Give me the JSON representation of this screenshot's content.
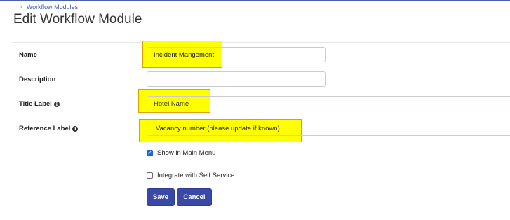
{
  "breadcrumb": {
    "separator": ">",
    "current": "Workflow Modules"
  },
  "page": {
    "title": "Edit Workflow Module"
  },
  "form": {
    "name": {
      "label": "Name",
      "value": "Incident Mangement"
    },
    "description": {
      "label": "Description",
      "value": ""
    },
    "title_label": {
      "label": "Title Label",
      "value": "Hotel Name",
      "info_icon": "info-circle-icon"
    },
    "reference_label": {
      "label": "Reference Label",
      "value": "Vacancy number (please update if known)",
      "info_icon": "info-circle-icon"
    },
    "show_in_main_menu": {
      "label": "Show in Main Menu",
      "checked": true
    },
    "integrate_self_service": {
      "label": "Integrate with Self Service",
      "checked": false
    }
  },
  "actions": {
    "save_label": "Save",
    "cancel_label": "Cancel"
  },
  "colors": {
    "accent": "#3a48a8",
    "highlight": "#ffff00",
    "checkbox": "#1a66d6"
  }
}
